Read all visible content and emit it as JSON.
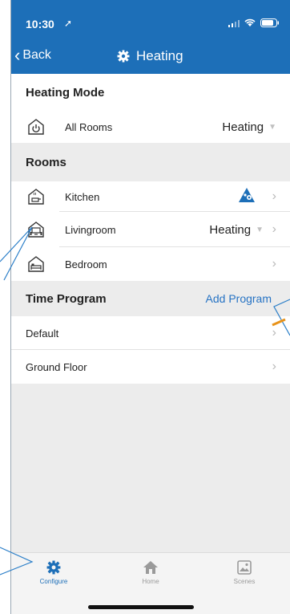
{
  "status_bar": {
    "time": "10:30"
  },
  "navbar": {
    "back_label": "Back",
    "title": "Heating"
  },
  "heating_mode": {
    "header": "Heating Mode",
    "row": {
      "label": "All Rooms",
      "value": "Heating"
    }
  },
  "rooms": {
    "header": "Rooms",
    "items": [
      {
        "label": "Kitchen",
        "value": ""
      },
      {
        "label": "Livingroom",
        "value": "Heating"
      },
      {
        "label": "Bedroom",
        "value": ""
      }
    ]
  },
  "time_program": {
    "header": "Time Program",
    "action": "Add Program",
    "items": [
      {
        "label": "Default"
      },
      {
        "label": "Ground Floor"
      }
    ]
  },
  "tabbar": {
    "tabs": [
      {
        "label": "Configure",
        "icon": "gear-icon",
        "active": true
      },
      {
        "label": "Home",
        "icon": "house-icon",
        "active": false
      },
      {
        "label": "Scenes",
        "icon": "image-icon",
        "active": false
      }
    ]
  },
  "colors": {
    "accent": "#1d6fb8",
    "link": "#2673c4",
    "background": "#ececec",
    "callout": "#2a7ec8",
    "arrow": "#e8931a"
  }
}
